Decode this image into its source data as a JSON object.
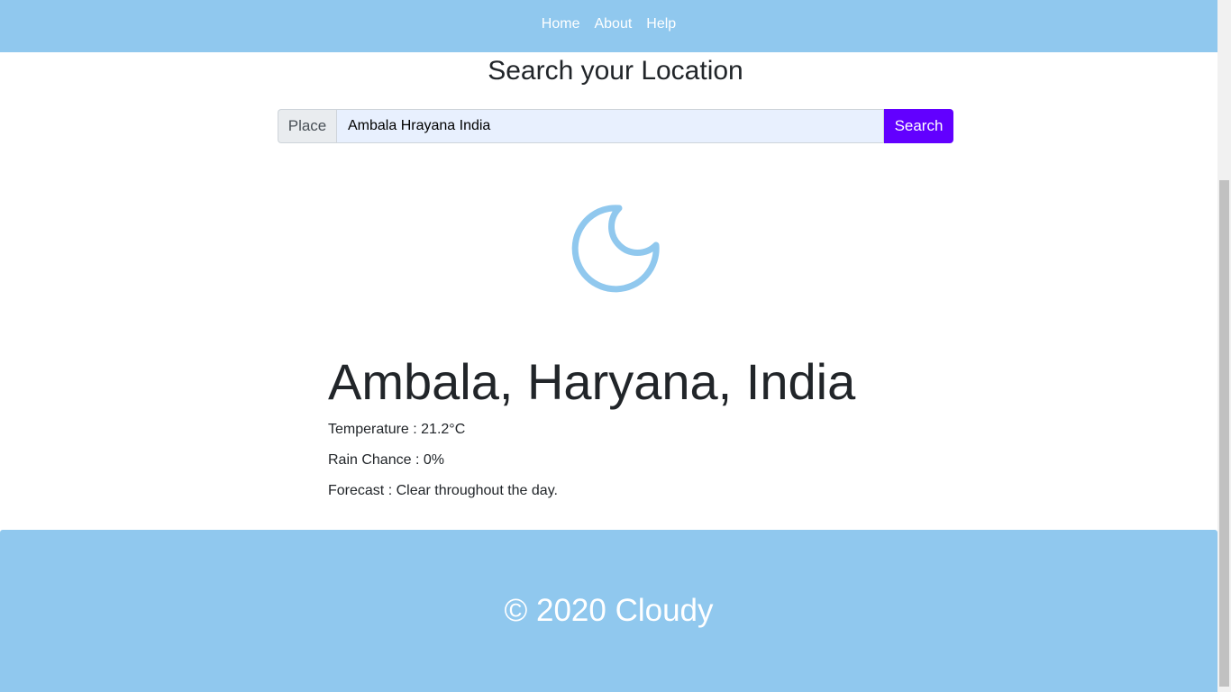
{
  "nav": {
    "links": [
      "Home",
      "About",
      "Help"
    ]
  },
  "search": {
    "title": "Search your Location",
    "prefix_label": "Place",
    "input_value": "Ambala Hrayana India",
    "button_label": "Search"
  },
  "weather": {
    "icon": "moon-icon",
    "icon_color": "#90c8ee",
    "location": "Ambala, Haryana, India",
    "temperature": "Temperature : 21.2°C",
    "rain_chance": "Rain Chance : 0%",
    "forecast": "Forecast : Clear throughout the day."
  },
  "footer": {
    "text": "© 2020 Cloudy"
  },
  "colors": {
    "nav_bg": "#90c8ee",
    "accent": "#6200ff",
    "input_bg": "#e8f0fe"
  }
}
